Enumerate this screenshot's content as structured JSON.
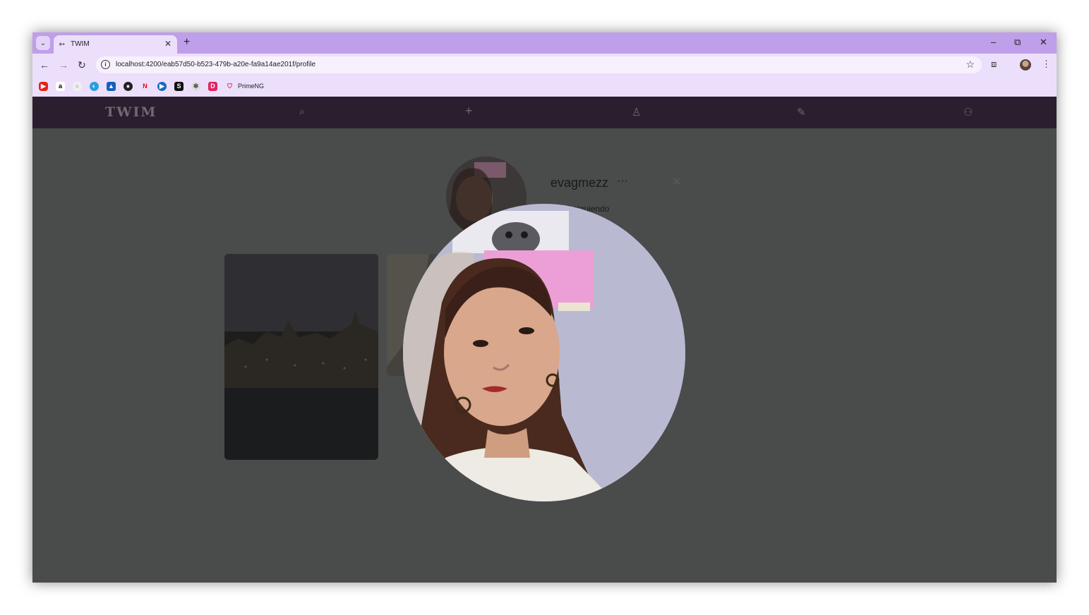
{
  "browser": {
    "tab_title": "TWIM",
    "url": "localhost:4200/eab57d50-b523-479b-a20e-fa9a14ae201f/profile",
    "bookmark_label": "PrimeNG",
    "tab_close": "✕",
    "new_tab": "+",
    "win_min": "–",
    "win_restore": "⧉",
    "win_close": "✕",
    "back": "←",
    "forward": "→",
    "reload": "↻",
    "info": "i",
    "star": "☆",
    "extensions": "⧈",
    "menu": "⋮"
  },
  "app": {
    "logo": "TWIM",
    "profile": {
      "username": "evagmezz",
      "more": "···",
      "close": "✕",
      "stats_visible": "as  2 siguiendo"
    }
  },
  "icons": [
    "search-icon",
    "plus-icon",
    "user-icon",
    "wrench-icon",
    "users-icon"
  ],
  "colors": {
    "tabbar": "#bf9eea",
    "toolbar": "#ecdffb",
    "appnav": "#2a1e2f",
    "overlay": "#4a4b4b"
  }
}
